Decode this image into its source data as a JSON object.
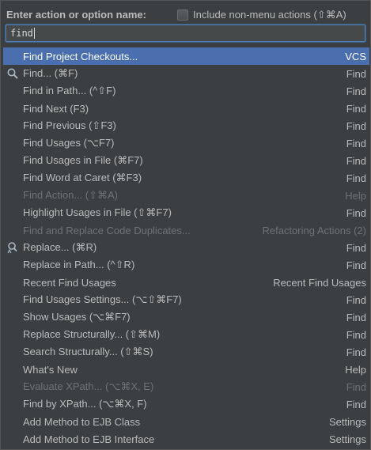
{
  "header": {
    "title": "Enter action or option name:",
    "checkbox_label": "Include non-menu actions (⇧⌘A)",
    "checkbox_checked": false
  },
  "search": {
    "value": "find"
  },
  "items": [
    {
      "name": "Find Project Checkouts...",
      "group": "VCS",
      "selected": true,
      "disabled": false,
      "icon": null
    },
    {
      "name": "Find... (⌘F)",
      "group": "Find",
      "selected": false,
      "disabled": false,
      "icon": "search-icon"
    },
    {
      "name": "Find in Path... (^⇧F)",
      "group": "Find",
      "selected": false,
      "disabled": false,
      "icon": null
    },
    {
      "name": "Find Next (F3)",
      "group": "Find",
      "selected": false,
      "disabled": false,
      "icon": null
    },
    {
      "name": "Find Previous (⇧F3)",
      "group": "Find",
      "selected": false,
      "disabled": false,
      "icon": null
    },
    {
      "name": "Find Usages (⌥F7)",
      "group": "Find",
      "selected": false,
      "disabled": false,
      "icon": null
    },
    {
      "name": "Find Usages in File (⌘F7)",
      "group": "Find",
      "selected": false,
      "disabled": false,
      "icon": null
    },
    {
      "name": "Find Word at Caret (⌘F3)",
      "group": "Find",
      "selected": false,
      "disabled": false,
      "icon": null
    },
    {
      "name": "Find Action... (⇧⌘A)",
      "group": "Help",
      "selected": false,
      "disabled": true,
      "icon": null
    },
    {
      "name": "Highlight Usages in File (⇧⌘F7)",
      "group": "Find",
      "selected": false,
      "disabled": false,
      "icon": null
    },
    {
      "name": "Find and Replace Code Duplicates...",
      "group": "Refactoring Actions (2)",
      "selected": false,
      "disabled": true,
      "icon": null
    },
    {
      "name": "Replace... (⌘R)",
      "group": "Find",
      "selected": false,
      "disabled": false,
      "icon": "replace-icon"
    },
    {
      "name": "Replace in Path... (^⇧R)",
      "group": "Find",
      "selected": false,
      "disabled": false,
      "icon": null
    },
    {
      "name": "Recent Find Usages",
      "group": "Recent Find Usages",
      "selected": false,
      "disabled": false,
      "icon": null
    },
    {
      "name": "Find Usages Settings... (⌥⇧⌘F7)",
      "group": "Find",
      "selected": false,
      "disabled": false,
      "icon": null
    },
    {
      "name": "Show Usages (⌥⌘F7)",
      "group": "Find",
      "selected": false,
      "disabled": false,
      "icon": null
    },
    {
      "name": "Replace Structurally... (⇧⌘M)",
      "group": "Find",
      "selected": false,
      "disabled": false,
      "icon": null
    },
    {
      "name": "Search Structurally... (⇧⌘S)",
      "group": "Find",
      "selected": false,
      "disabled": false,
      "icon": null
    },
    {
      "name": "What's New",
      "group": "Help",
      "selected": false,
      "disabled": false,
      "icon": null
    },
    {
      "name": "Evaluate XPath... (⌥⌘X, E)",
      "group": "Find",
      "selected": false,
      "disabled": true,
      "icon": null
    },
    {
      "name": "Find by XPath... (⌥⌘X, F)",
      "group": "Find",
      "selected": false,
      "disabled": false,
      "icon": null
    },
    {
      "name": "Add Method to EJB Class",
      "group": "Settings",
      "selected": false,
      "disabled": false,
      "icon": null
    },
    {
      "name": "Add Method to EJB Interface",
      "group": "Settings",
      "selected": false,
      "disabled": false,
      "icon": null
    }
  ],
  "colors": {
    "background": "#3c3f41",
    "selection": "#4b6eaf",
    "text": "#bbbbbb",
    "disabled_text": "#6f7173",
    "search_border": "#4e7fb6"
  }
}
